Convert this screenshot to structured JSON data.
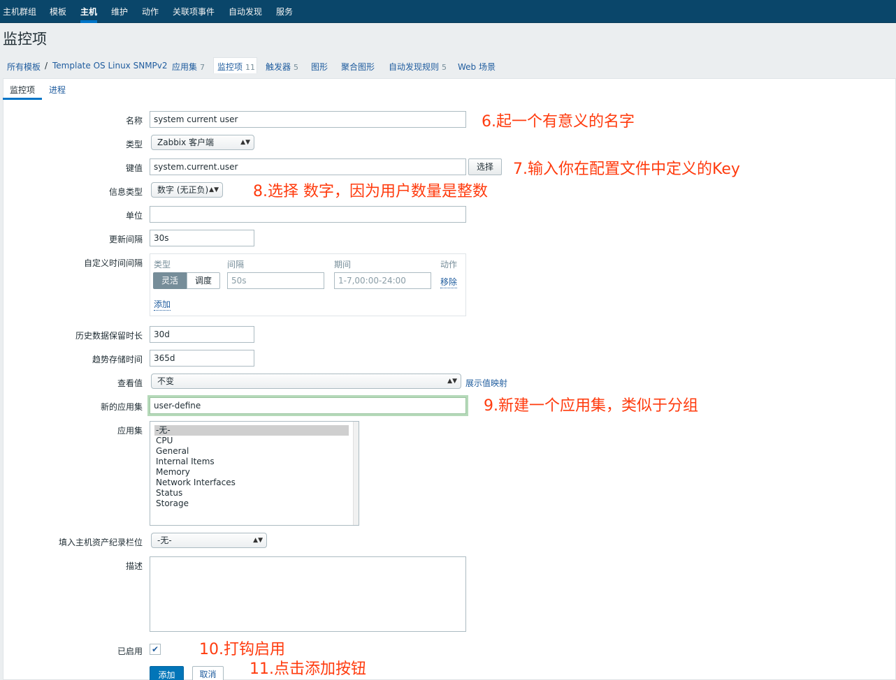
{
  "nav": {
    "items": [
      "主机群组",
      "模板",
      "主机",
      "维护",
      "动作",
      "关联项事件",
      "自动发现",
      "服务"
    ],
    "active": "主机"
  },
  "page": {
    "title": "监控项"
  },
  "breadcrumb": {
    "all_templates": "所有模板",
    "separator": "/",
    "template": "Template OS Linux SNMPv2",
    "apps": "应用集",
    "apps_count": "7",
    "items": "监控项",
    "items_count": "11",
    "triggers": "触发器",
    "triggers_count": "5",
    "graphs": "图形",
    "screens": "聚合图形",
    "discovery": "自动发现规则",
    "discovery_count": "5",
    "web": "Web 场景"
  },
  "tabs": {
    "item": "监控项",
    "process": "进程"
  },
  "form": {
    "name_label": "名称",
    "name_value": "system current user",
    "type_label": "类型",
    "type_value": "Zabbix 客户端",
    "key_label": "键值",
    "key_value": "system.current.user",
    "key_select_btn": "选择",
    "info_type_label": "信息类型",
    "info_type_value": "数字 (无正负)",
    "units_label": "单位",
    "units_value": "",
    "interval_label": "更新间隔",
    "interval_value": "30s",
    "custom_label": "自定义时间间隔",
    "custom_col_type": "类型",
    "custom_col_interval": "间隔",
    "custom_col_period": "期间",
    "custom_col_action": "动作",
    "custom_flexible": "灵活",
    "custom_scheduling": "调度",
    "custom_interval_placeholder": "50s",
    "custom_period_placeholder": "1-7,00:00-24:00",
    "custom_remove": "移除",
    "custom_add": "添加",
    "history_label": "历史数据保留时长",
    "history_value": "30d",
    "trends_label": "趋势存储时间",
    "trends_value": "365d",
    "valuemap_label": "查看值",
    "valuemap_value": "不变",
    "valuemap_link": "展示值映射",
    "new_app_label": "新的应用集",
    "new_app_value": "user-define",
    "apps_label": "应用集",
    "apps_options": [
      "-无-",
      "CPU",
      "General",
      "Internal Items",
      "Memory",
      "Network Interfaces",
      "Status",
      "Storage"
    ],
    "inventory_label": "填入主机资产纪录栏位",
    "inventory_value": "-无-",
    "desc_label": "描述",
    "enabled_label": "已启用",
    "add_btn": "添加",
    "cancel_btn": "取消"
  },
  "annotations": {
    "a6": "6.起一个有意义的名字",
    "a7": "7.输入你在配置文件中定义的Key",
    "a8": "8.选择 数字，因为用户数量是整数",
    "a9": "9.新建一个应用集，类似于分组",
    "a10": "10.打钩启用",
    "a11": "11.点击添加按钮"
  },
  "colors": {
    "nav_bg": "#0a466a",
    "accent": "#0275b8",
    "annotation": "#ff3b0e",
    "link": "#1f5c9e"
  }
}
